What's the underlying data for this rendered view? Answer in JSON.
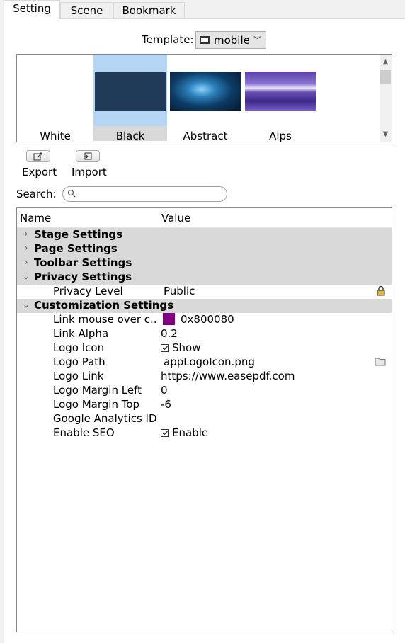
{
  "tabs": [
    {
      "label": "Setting",
      "active": true
    },
    {
      "label": "Scene",
      "active": false
    },
    {
      "label": "Bookmark",
      "active": false
    }
  ],
  "template": {
    "label": "Template:",
    "value": "mobile"
  },
  "gallery": [
    {
      "caption": "White",
      "selected": false
    },
    {
      "caption": "Black",
      "selected": true
    },
    {
      "caption": "Abstract",
      "selected": false
    },
    {
      "caption": "Alps",
      "selected": false
    }
  ],
  "actions": {
    "export_label": "Export",
    "import_label": "Import"
  },
  "search": {
    "label": "Search:",
    "value": "",
    "placeholder": ""
  },
  "grid": {
    "col_name": "Name",
    "col_value": "Value",
    "categories": [
      {
        "label": "Stage Settings",
        "expanded": false
      },
      {
        "label": "Page Settings",
        "expanded": false
      },
      {
        "label": "Toolbar Settings",
        "expanded": false
      },
      {
        "label": "Privacy Settings",
        "expanded": true
      },
      {
        "label": "Customization Settings",
        "expanded": true
      }
    ],
    "privacy": [
      {
        "name": "Privacy Level",
        "value": "Public"
      }
    ],
    "customization": [
      {
        "name": "Link mouse over c...",
        "value": "0x800080",
        "color": "#800080"
      },
      {
        "name": "Link Alpha",
        "value": "0.2"
      },
      {
        "name": "Logo Icon",
        "value": "Show",
        "checked": true
      },
      {
        "name": "Logo Path",
        "value": "appLogoIcon.png"
      },
      {
        "name": "Logo Link",
        "value": "https://www.easepdf.com"
      },
      {
        "name": "Logo Margin Left",
        "value": "0"
      },
      {
        "name": "Logo Margin Top",
        "value": "-6"
      },
      {
        "name": "Google Analytics ID",
        "value": ""
      },
      {
        "name": "Enable SEO",
        "value": "Enable",
        "checked": true
      }
    ]
  }
}
